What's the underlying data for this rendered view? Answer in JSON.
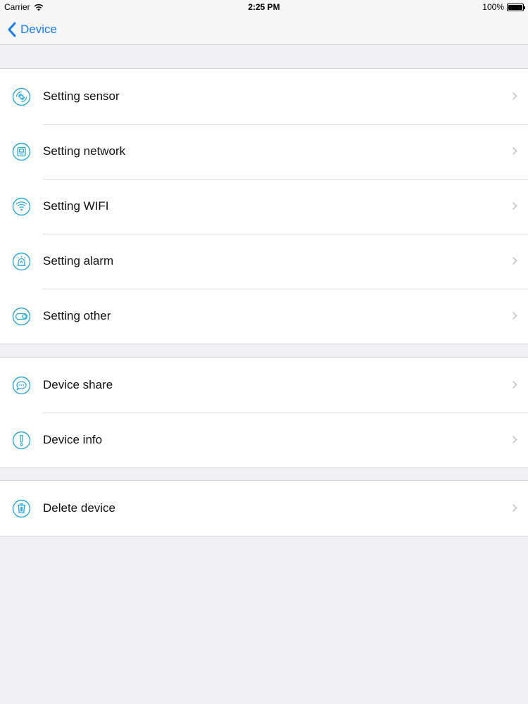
{
  "status_bar": {
    "carrier": "Carrier",
    "time": "2:25 PM",
    "battery": "100%"
  },
  "nav": {
    "back_label": "Device"
  },
  "groups": [
    {
      "items": [
        {
          "label": "Setting sensor",
          "icon": "sensor-icon"
        },
        {
          "label": "Setting network",
          "icon": "network-icon"
        },
        {
          "label": "Setting WIFI",
          "icon": "wifi-icon"
        },
        {
          "label": "Setting alarm",
          "icon": "alarm-icon"
        },
        {
          "label": "Setting other",
          "icon": "toggle-icon"
        }
      ]
    },
    {
      "items": [
        {
          "label": "Device share",
          "icon": "share-chat-icon"
        },
        {
          "label": "Device info",
          "icon": "info-icon"
        }
      ]
    },
    {
      "items": [
        {
          "label": "Delete device",
          "icon": "trash-icon"
        }
      ]
    }
  ],
  "colors": {
    "accent": "#157efb",
    "icon": "#29a8e0",
    "background": "#efeff4"
  }
}
